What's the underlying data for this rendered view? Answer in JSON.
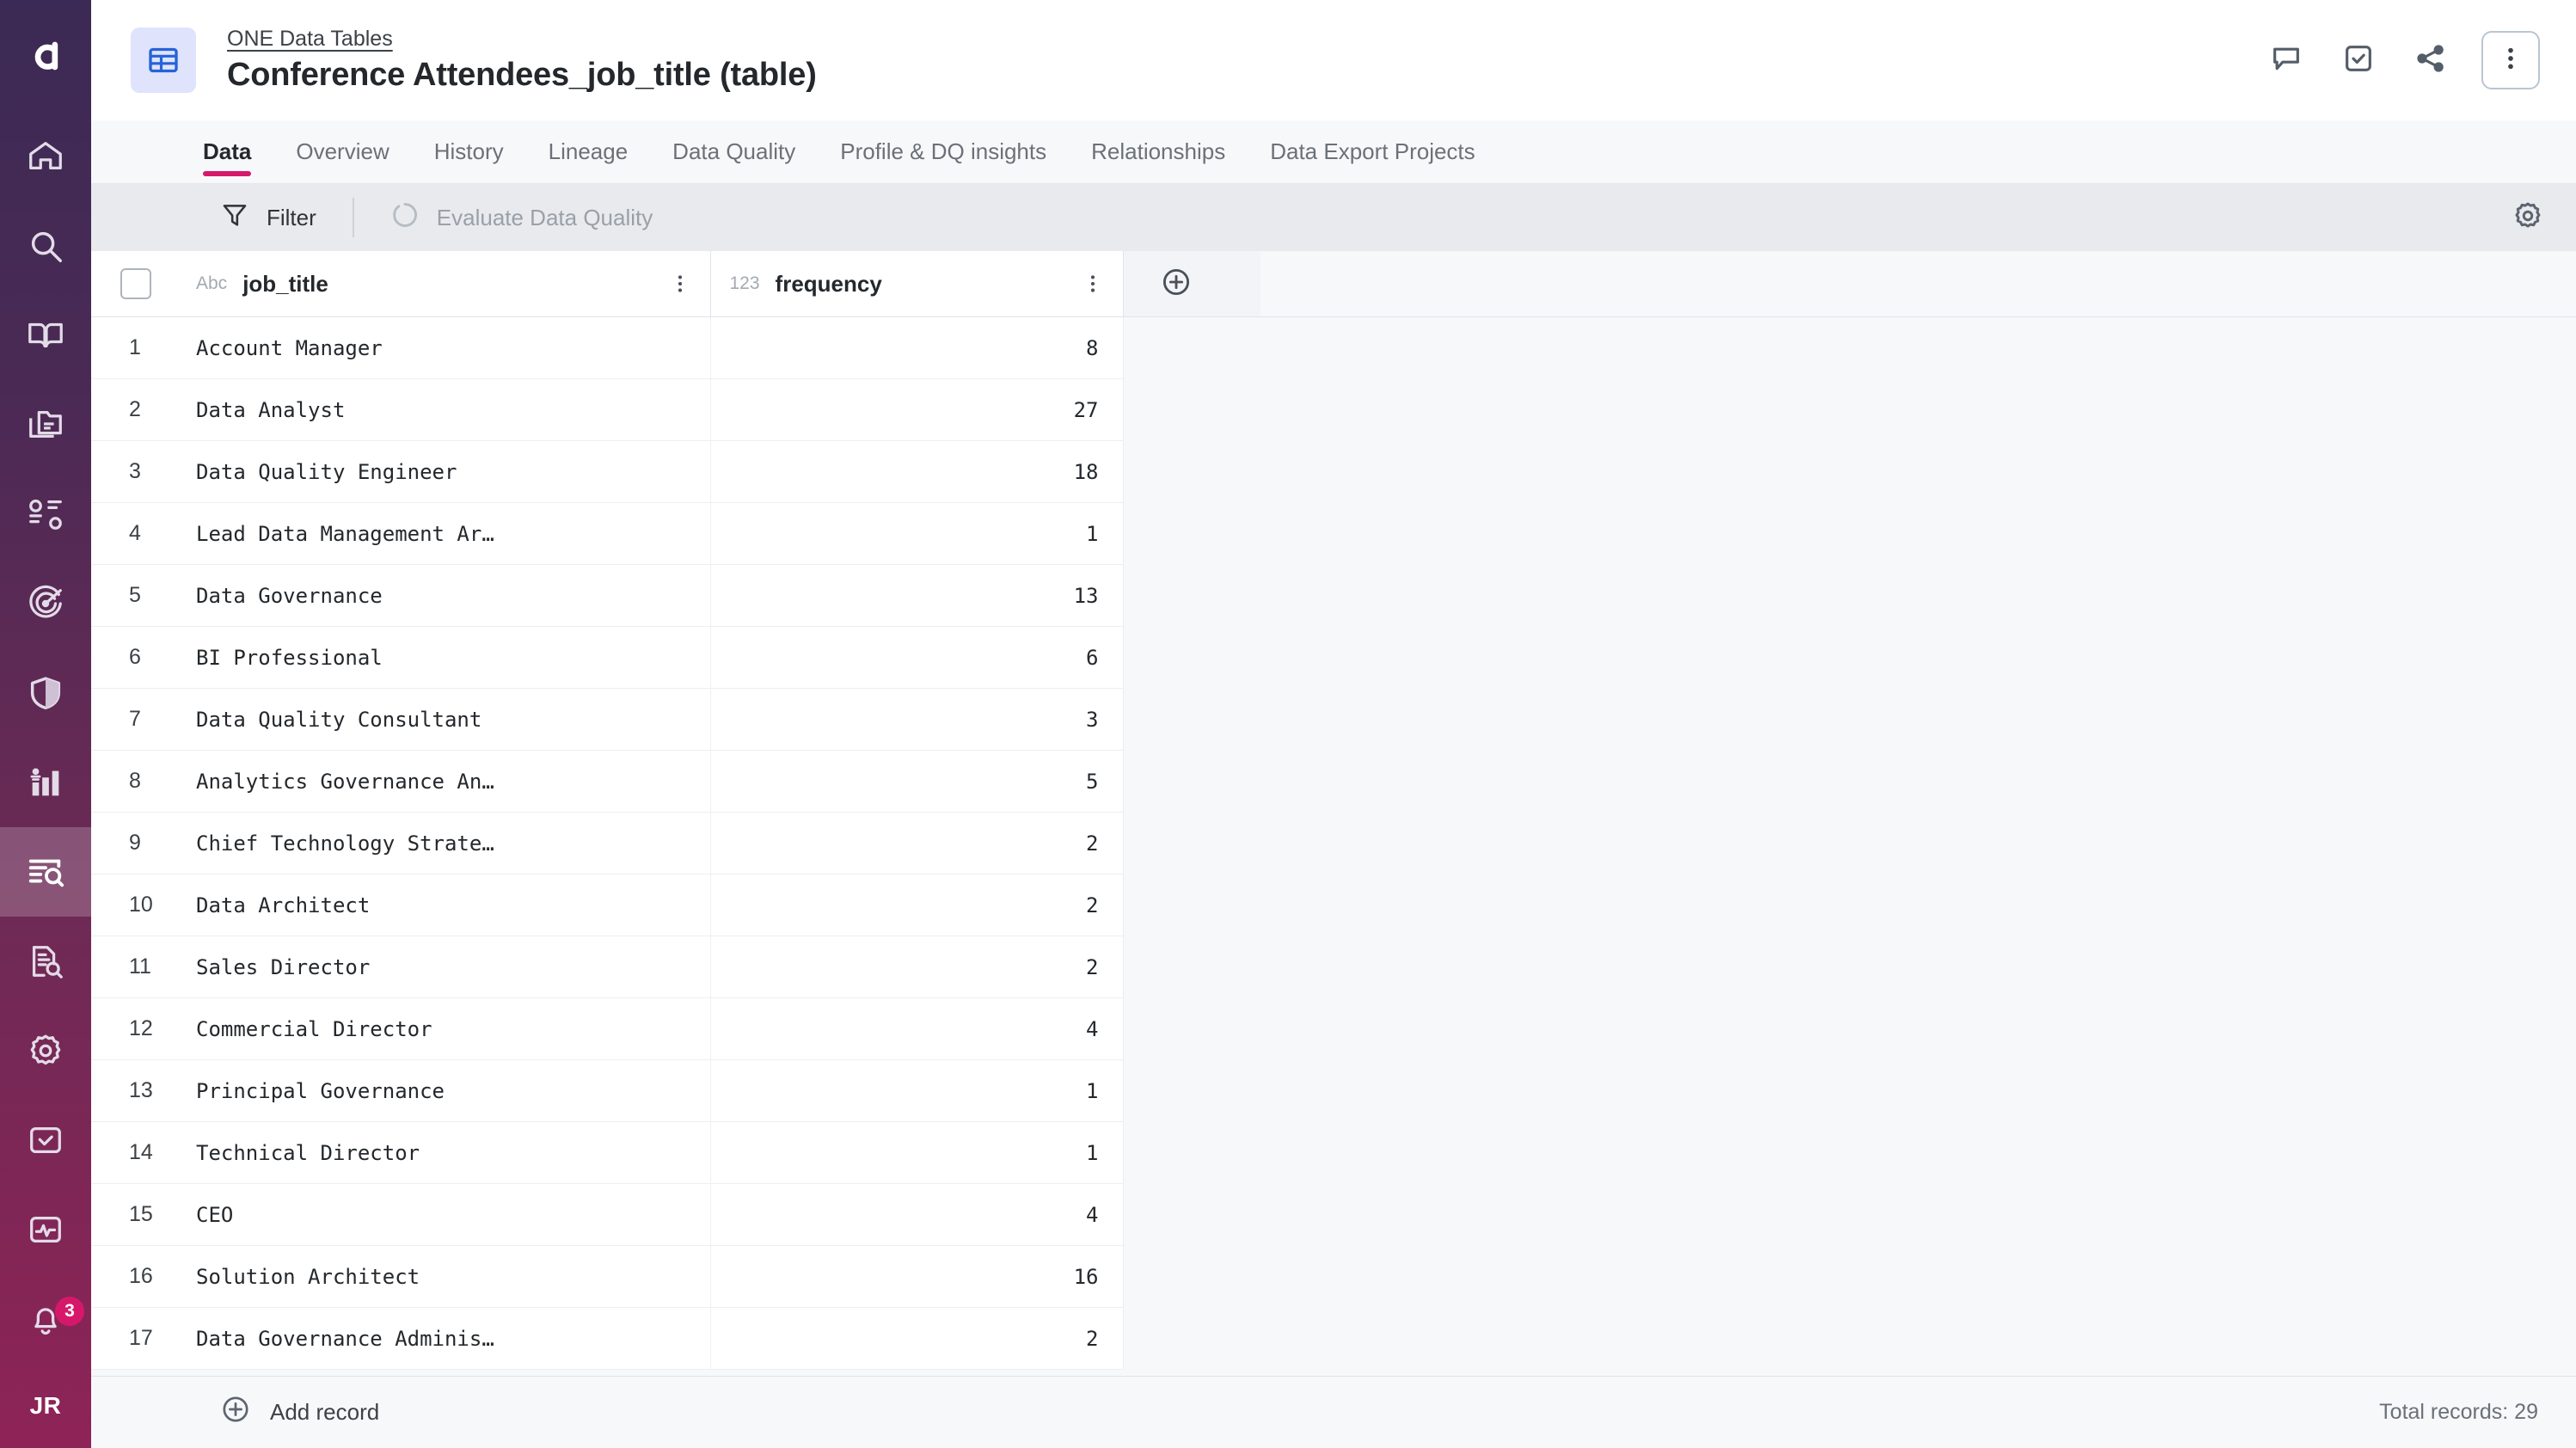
{
  "sidebar": {
    "logo": "ataccama-logo",
    "items": [
      {
        "name": "home",
        "icon": "home-icon",
        "active": false
      },
      {
        "name": "search",
        "icon": "search-icon",
        "active": false
      },
      {
        "name": "glossary",
        "icon": "book-icon",
        "active": false
      },
      {
        "name": "catalog",
        "icon": "folders-icon",
        "active": false
      },
      {
        "name": "sources",
        "icon": "list-items-icon",
        "active": false
      },
      {
        "name": "monitoring",
        "icon": "radar-target-icon",
        "active": false
      },
      {
        "name": "policies",
        "icon": "shield-icon",
        "active": false
      },
      {
        "name": "reports",
        "icon": "bar-chart-icon",
        "active": false
      },
      {
        "name": "data-tables",
        "icon": "table-search-icon",
        "active": true
      },
      {
        "name": "data-explorer",
        "icon": "document-search-icon",
        "active": false
      },
      {
        "name": "settings",
        "icon": "gear-icon",
        "active": false
      },
      {
        "name": "tasks",
        "icon": "checkbox-icon",
        "active": false
      },
      {
        "name": "activity",
        "icon": "monitor-pulse-icon",
        "active": false
      }
    ],
    "notifications": {
      "icon": "bell-icon",
      "badge": "3"
    },
    "avatar": {
      "initials": "JR"
    }
  },
  "header": {
    "icon": "table-tile-icon",
    "breadcrumb": "ONE Data Tables",
    "title": "Conference Attendees_job_title (table)",
    "actions": [
      {
        "name": "comments-button",
        "icon": "comment-icon"
      },
      {
        "name": "tasks-button",
        "icon": "checkbox-check-icon"
      },
      {
        "name": "share-button",
        "icon": "share-icon"
      },
      {
        "name": "more-options-button",
        "icon": "kebab-menu-icon"
      }
    ]
  },
  "tabs": [
    {
      "label": "Data",
      "active": true
    },
    {
      "label": "Overview",
      "active": false
    },
    {
      "label": "History",
      "active": false
    },
    {
      "label": "Lineage",
      "active": false
    },
    {
      "label": "Data Quality",
      "active": false
    },
    {
      "label": "Profile & DQ insights",
      "active": false
    },
    {
      "label": "Relationships",
      "active": false
    },
    {
      "label": "Data Export Projects",
      "active": false
    }
  ],
  "toolbar": {
    "filter_label": "Filter",
    "filter_icon": "funnel-icon",
    "evaluate_label": "Evaluate Data Quality",
    "evaluate_icon": "circle-spinner-icon",
    "evaluate_disabled": true,
    "settings_icon": "gear-icon"
  },
  "table": {
    "columns": [
      {
        "name": "job_title",
        "type_label": "Abc",
        "type": "text"
      },
      {
        "name": "frequency",
        "type_label": "123",
        "type": "number"
      }
    ],
    "add_column_label": "+",
    "rows": [
      {
        "n": "1",
        "job_title": "Account Manager",
        "frequency": "8"
      },
      {
        "n": "2",
        "job_title": "Data Analyst",
        "frequency": "27"
      },
      {
        "n": "3",
        "job_title": "Data Quality Engineer",
        "frequency": "18"
      },
      {
        "n": "4",
        "job_title": "Lead Data Management Ar…",
        "frequency": "1"
      },
      {
        "n": "5",
        "job_title": "Data Governance",
        "frequency": "13"
      },
      {
        "n": "6",
        "job_title": "BI Professional",
        "frequency": "6"
      },
      {
        "n": "7",
        "job_title": "Data Quality Consultant",
        "frequency": "3"
      },
      {
        "n": "8",
        "job_title": "Analytics Governance An…",
        "frequency": "5"
      },
      {
        "n": "9",
        "job_title": "Chief Technology Strate…",
        "frequency": "2"
      },
      {
        "n": "10",
        "job_title": "Data Architect",
        "frequency": "2"
      },
      {
        "n": "11",
        "job_title": "Sales Director",
        "frequency": "2"
      },
      {
        "n": "12",
        "job_title": "Commercial Director",
        "frequency": "4"
      },
      {
        "n": "13",
        "job_title": "Principal Governance",
        "frequency": "1"
      },
      {
        "n": "14",
        "job_title": "Technical Director",
        "frequency": "1"
      },
      {
        "n": "15",
        "job_title": "CEO",
        "frequency": "4"
      },
      {
        "n": "16",
        "job_title": "Solution Architect",
        "frequency": "16"
      },
      {
        "n": "17",
        "job_title": "Data Governance Adminis…",
        "frequency": "2"
      }
    ]
  },
  "footer": {
    "add_record_label": "Add record",
    "add_record_icon": "plus-circle-icon",
    "total_records_label": "Total records: 29"
  },
  "colors": {
    "rail_top": "#3b2a55",
    "rail_bottom": "#8e2357",
    "accent_pink": "#d6186b",
    "tile_blue": "#dfe3fb",
    "icon_blue": "#2563d9",
    "toolbar_bg": "#e8eaee",
    "panel_bg": "#f7f8fa"
  }
}
